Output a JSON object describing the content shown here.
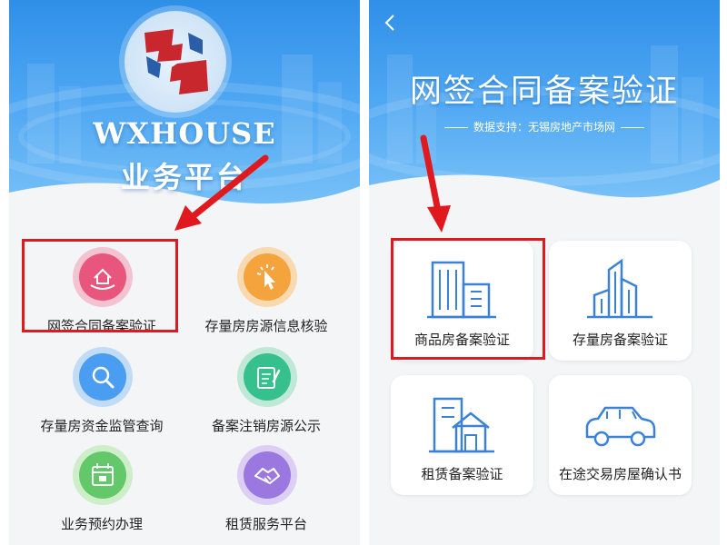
{
  "left": {
    "brand_title": "WXHOUSE",
    "brand_subtitle": "业务平台",
    "menu": [
      {
        "label": "网签合同备案验证",
        "icon": "house-in-hand-icon",
        "color": "#e8567d"
      },
      {
        "label": "存量房房源信息核验",
        "icon": "cursor-click-icon",
        "color": "#f5a33c"
      },
      {
        "label": "存量房资金监管查询",
        "icon": "magnifier-icon",
        "color": "#4a9df0"
      },
      {
        "label": "备案注销房源公示",
        "icon": "notepad-pen-icon",
        "color": "#35c08d"
      },
      {
        "label": "业务预约办理",
        "icon": "calendar-icon",
        "color": "#63c86a"
      },
      {
        "label": "租赁服务平台",
        "icon": "handshake-icon",
        "color": "#9a78e0"
      }
    ]
  },
  "right": {
    "title": "网签合同备案验证",
    "source": "数据支持：无锡房地产市场网",
    "cards": [
      {
        "label": "商品房备案验证",
        "icon": "office-buildings-icon"
      },
      {
        "label": "存量房备案验证",
        "icon": "skyscrapers-icon"
      },
      {
        "label": "租赁备案验证",
        "icon": "rental-house-icon"
      },
      {
        "label": "在途交易房屋确认书",
        "icon": "car-icon"
      }
    ]
  },
  "colors": {
    "hero_blue": "#2f8fe8",
    "icon_line_blue": "#3b82d6",
    "highlight_red": "#e0191f",
    "page_bg": "#f4f5f7"
  }
}
